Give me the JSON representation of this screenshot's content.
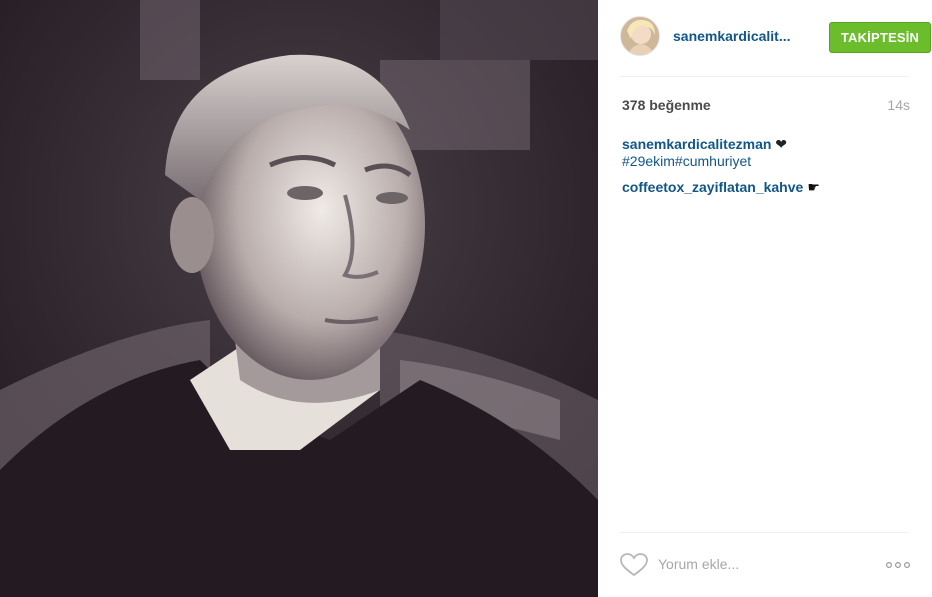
{
  "post": {
    "image_alt": "Black and white portrait photograph",
    "username": "sanemkardicalit...",
    "follow_label": "TAKİPTESİN",
    "likes": "378 beğenme",
    "time": "14s",
    "caption_author": "sanemkardicalitezman",
    "caption_text": "❤",
    "caption_tags": "#29ekim#cumhuriyet",
    "comment_user": "coffeetox_zayiflatan_kahve",
    "comment_text": "☛",
    "comment_placeholder": "Yorum ekle..."
  },
  "colors": {
    "follow_green": "#6bbd2c",
    "link_blue": "#125688",
    "muted_gray": "#a5a7aa"
  },
  "icons": {
    "like": "heart-outline-icon",
    "more": "more-dots-icon"
  }
}
